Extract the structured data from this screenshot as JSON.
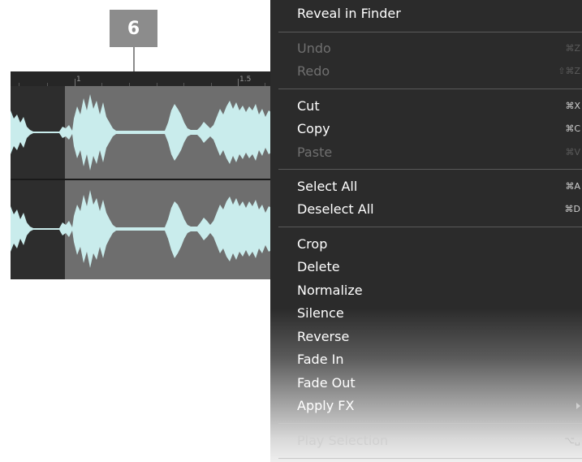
{
  "callout": {
    "number": "6"
  },
  "ruler": {
    "labels": [
      "1",
      "1.5"
    ]
  },
  "menu": {
    "items": [
      {
        "label": "Reveal in Finder",
        "shortcut": ""
      },
      {
        "label": "Undo",
        "shortcut": "⌘Z"
      },
      {
        "label": "Redo",
        "shortcut": "⇧⌘Z"
      },
      {
        "label": "Cut",
        "shortcut": "⌘X"
      },
      {
        "label": "Copy",
        "shortcut": "⌘C"
      },
      {
        "label": "Paste",
        "shortcut": "⌘V"
      },
      {
        "label": "Select All",
        "shortcut": "⌘A"
      },
      {
        "label": "Deselect All",
        "shortcut": "⌘D"
      },
      {
        "label": "Crop",
        "shortcut": ""
      },
      {
        "label": "Delete",
        "shortcut": ""
      },
      {
        "label": "Normalize",
        "shortcut": ""
      },
      {
        "label": "Silence",
        "shortcut": ""
      },
      {
        "label": "Reverse",
        "shortcut": ""
      },
      {
        "label": "Fade In",
        "shortcut": ""
      },
      {
        "label": "Fade Out",
        "shortcut": ""
      },
      {
        "label": "Apply FX",
        "shortcut": ""
      },
      {
        "label": "Play Selection",
        "shortcut": "⌥␣"
      }
    ]
  },
  "colors": {
    "waveform": "#c9ecec",
    "selection": "#6e6e6e",
    "menu_background": "#2b2b2b",
    "callout": "#8c8c8c"
  }
}
